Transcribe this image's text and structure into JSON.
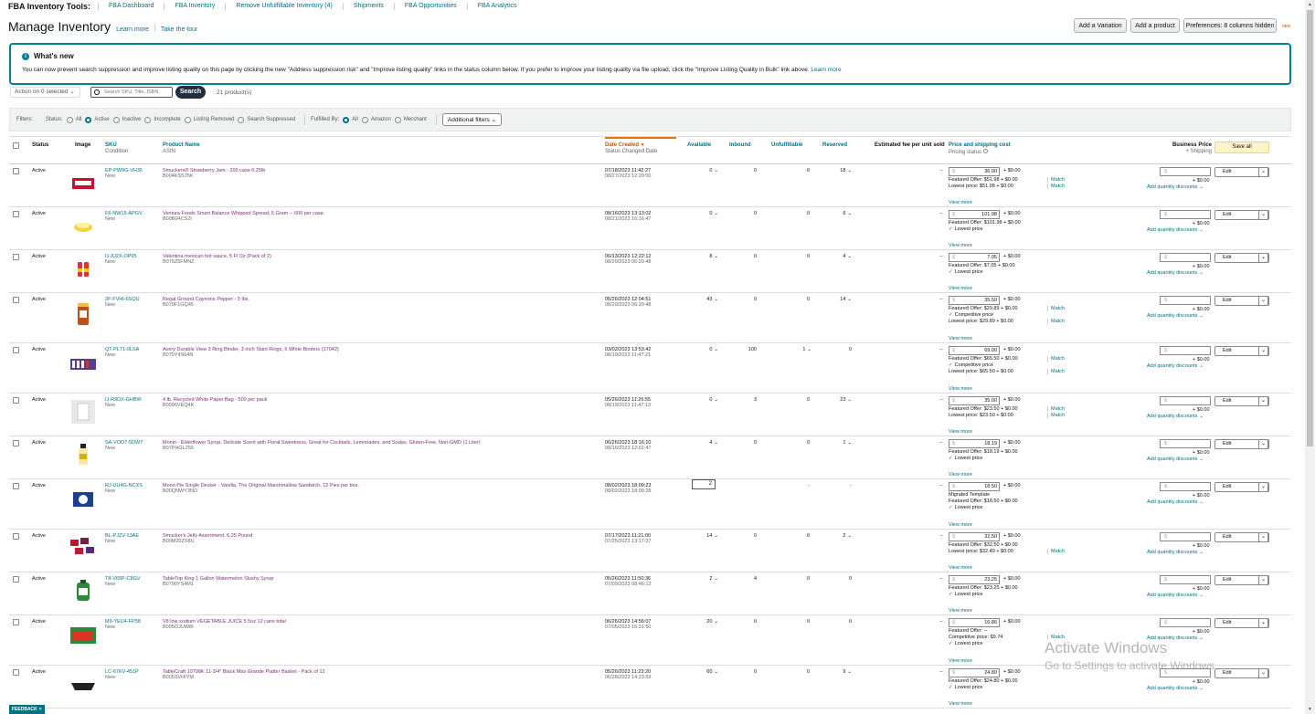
{
  "topnav": {
    "title": "FBA Inventory Tools:",
    "items": [
      "FBA Dashboard",
      "FBA Inventory",
      "Remove Unfulfillable Inventory (4)",
      "Shipments",
      "FBA Opportunities",
      "FBA Analytics"
    ]
  },
  "page": {
    "title": "Manage Inventory",
    "learn_more": "Learn more",
    "take_tour": "Take the tour"
  },
  "header_buttons": {
    "add_variation": "Add a Variation",
    "add_product": "Add a product",
    "preferences": "Preferences: 8 columns hidden",
    "new_tag": "new"
  },
  "whats_new": {
    "title": "What's new",
    "body": "You can now prevent search suppression and improve listing quality on this page by clicking the new \"Address suppression risk\" and \"Improve listing quality\" links in the status column below. If you prefer to improve your listing quality via file upload, click the \"Improve Listing Quality in Bulk\" link above.",
    "link": "Learn more"
  },
  "actionbar": {
    "action_label": "Action on 0 selected",
    "search_placeholder": "Search SKU, Title, ISBN,",
    "search_button": "Search",
    "count": "21 product(s)"
  },
  "filters": {
    "label": "Filters:",
    "status_label": "Status:",
    "status_options": [
      "All",
      "Active",
      "Inactive",
      "Incomplete",
      "Listing Removed",
      "Search Suppressed"
    ],
    "status_selected": "Active",
    "fulfilled_label": "Fulfilled By:",
    "fulfilled_options": [
      "All",
      "Amazon",
      "Merchant"
    ],
    "fulfilled_selected": "All",
    "additional": "Additional filters"
  },
  "columns": {
    "status": "Status",
    "image": "Image",
    "sku": "SKU",
    "sku_sub": "Condition",
    "product": "Product Name",
    "product_sub": "ASIN",
    "date": "Date Created",
    "date_sub": "Status Changed Date",
    "available": "Available",
    "inbound": "Inbound",
    "unfulfillable": "Unfulfillable",
    "reserved": "Reserved",
    "fee": "Estimated fee per unit sold",
    "price": "Price and shipping cost",
    "price_sub": "Pricing status",
    "business": "Business Price",
    "business_sub": "+ Shipping",
    "save_all": "Save all"
  },
  "common": {
    "view_more": "View more",
    "add_qty": "Add quantity discounts",
    "edit": "Edit",
    "plus_ship": "+ $0.00",
    "dash": "--"
  },
  "rows": [
    {
      "status": "Active",
      "sku": "EP-PW9G-VH35",
      "cond": "New",
      "name": "Smuckers® Strawberry Jam - 200 case 0.25lb",
      "asin": "B004KSS75K",
      "created": "07/18/2023 11:42:27",
      "changed": "08/27/2023 12:29:00",
      "avail": "0",
      "inbound": "0",
      "unful": "0",
      "reserved": "18",
      "price": "36.00",
      "ship": "+ $0.00",
      "lines": [
        "Featured Offer: $51.98 + $0.00",
        "Lowest price: $51.98 + $0.00"
      ],
      "match": [
        "Match",
        "Match"
      ],
      "check": "",
      "img": "jam"
    },
    {
      "status": "Active",
      "sku": "F6-NW15-APGV",
      "cond": "New",
      "name": "Ventura Foods Smart Balance Whipped Spread, 5 Gram -- 600 per case.",
      "asin": "B00B04CS2I",
      "created": "08/16/2023 13:13:02",
      "changed": "08/21/2023 16:16:47",
      "avail": "0",
      "inbound": "0",
      "unful": "0",
      "reserved": "6",
      "price": "101.98",
      "ship": "+ $0.00",
      "lines": [
        "Featured Offer: $101.98 + $0.00"
      ],
      "match": [],
      "check": "Lowest price",
      "img": "spread"
    },
    {
      "status": "Active",
      "sku": "I1-IU2X-OP95",
      "cond": "New",
      "name": "Valentina mexican hot sauce, 5 Fl Oz (Pack of 2)",
      "asin": "B076Z5FMNZ",
      "created": "06/13/2023 12:22:12",
      "changed": "08/20/2023 06:20:48",
      "avail": "8",
      "inbound": "0",
      "unful": "0",
      "reserved": "4",
      "price": "7.05",
      "ship": "+ $0.00",
      "lines": [
        "Featured Offer: $7.05 + $0.00"
      ],
      "match": [],
      "check": "Lowest price",
      "img": "sauce"
    },
    {
      "status": "Active",
      "sku": "2F-FVHI-6SQU",
      "cond": "New",
      "name": "Regal Ground Cayenne Pepper - 5 lbs.",
      "asin": "B079F1GQ45",
      "created": "05/26/2023 12:04:51",
      "changed": "08/20/2023 06:20:48",
      "avail": "43",
      "inbound": "0",
      "unful": "0",
      "reserved": "14",
      "price": "35.50",
      "ship": "+ $0.00",
      "lines": [
        "Featured Offer: $29.89 + $0.00",
        "Competitive price",
        "Lowest price: $29.89 + $0.00"
      ],
      "match": [
        "Match",
        "",
        "Match"
      ],
      "check": "",
      "img": "pepper"
    },
    {
      "status": "Active",
      "sku": "QT-PL71-0LSA",
      "cond": "New",
      "name": "Avery Durable View 3 Ring Binder, 3 Inch Slant Rings, 6 White Binders (17042)",
      "asin": "B079Y4S64N",
      "created": "03/02/2023 13:53:42",
      "changed": "08/19/2023 11:47:21",
      "avail": "0",
      "inbound": "100",
      "unful": "1",
      "reserved": "0",
      "price": "69.00",
      "ship": "+ $0.00",
      "lines": [
        "Featured Offer: $65.50 + $0.00",
        "Competitive price",
        "Lowest price: $65.50 + $0.00"
      ],
      "match": [
        "Match",
        "",
        "Match"
      ],
      "check": "",
      "img": "binder"
    },
    {
      "status": "Active",
      "sku": "IJ-R9DX-GHBW",
      "cond": "New",
      "name": "4 lb. Recycled White Paper Bag - 500 per pack",
      "asin": "B0096VEQ4K",
      "created": "05/26/2023 11:26:55",
      "changed": "08/19/2023 11:47:13",
      "avail": "0",
      "inbound": "3",
      "unful": "0",
      "reserved": "23",
      "price": "35.00",
      "ship": "+ $0.00",
      "lines": [
        "Featured Offer: $23.50 + $0.00",
        "Lowest price: $23.50 + $0.00"
      ],
      "match": [
        "Match",
        "Match"
      ],
      "check": "",
      "img": "bag"
    },
    {
      "status": "Active",
      "sku": "SA-VOD7-5DW7",
      "cond": "New",
      "name": "Monin - Elderflower Syrup, Delicate Scent with Floral Sweetness, Great for Cocktails, Lemonades, and Sodas, Gluten-Free, Non-GMO (1 Liter)",
      "asin": "B07PHGL255",
      "created": "06/26/2023 18:16:10",
      "changed": "08/16/2023 12:01:47",
      "avail": "4",
      "inbound": "0",
      "unful": "0",
      "reserved": "1",
      "price": "18.19",
      "ship": "+ $0.00",
      "lines": [
        "Featured Offer: $18.19 + $0.00"
      ],
      "match": [],
      "check": "Lowest price",
      "img": "syrup"
    },
    {
      "status": "Active",
      "sku": "RJ-UU4G-NCXS",
      "cond": "New",
      "name": "Moon Pie Single Decker - Vanilla, The Original Marshmallow Sandwich, 12 Pies per box.",
      "asin": "B00QNWY3NO",
      "created": "08/02/2023 18:09:23",
      "changed": "08/02/2023 18:09:28",
      "avail": "2",
      "inbound": "",
      "unful": "-",
      "reserved": "-",
      "price": "18.50",
      "ship": "+ $0.00",
      "lines": [
        "Migrated Template",
        "Featured Offer: $18.50 + $0.00"
      ],
      "match": [],
      "check": "Lowest price",
      "img": "moonpie"
    },
    {
      "status": "Active",
      "sku": "BL-PJZV-13AE",
      "cond": "New",
      "name": "Smucker's Jelly Assortment, 6.25 Pound",
      "asin": "B00M20ZX8U",
      "created": "07/17/2023 11:21:00",
      "changed": "07/25/2023 13:17:27",
      "avail": "14",
      "inbound": "0",
      "unful": "0",
      "reserved": "2",
      "price": "32.50",
      "ship": "+ $0.00",
      "lines": [
        "Featured Offer: $32.50 + $0.00",
        "Lowest price: $32.49 + $0.00"
      ],
      "match": [
        "",
        "Match"
      ],
      "check": "",
      "img": "jelly"
    },
    {
      "status": "Active",
      "sku": "T8-V65P-C8GV",
      "cond": "New",
      "name": "TableTop King 1 Gallon Watermelon Slushy Syrup",
      "asin": "B0790YS4M1",
      "created": "05/26/2023 11:50:36",
      "changed": "07/09/2023 08:46:13",
      "avail": "2",
      "inbound": "4",
      "unful": "0",
      "reserved": "0",
      "price": "23.25",
      "ship": "+ $0.00",
      "lines": [
        "Featured Offer: $23.25 + $0.00"
      ],
      "match": [],
      "check": "Lowest price",
      "img": "slushy"
    },
    {
      "status": "Active",
      "sku": "M9-YEU4-FP58",
      "cond": "New",
      "name": "V8 low sodium VEGETABLE JUICE 5.5oz 12 cans total",
      "asin": "B005OJUW8I",
      "created": "06/26/2023 14:56:07",
      "changed": "07/05/2023 15:21:50",
      "avail": "20",
      "inbound": "0",
      "unful": "0",
      "reserved": "0",
      "price": "16.86",
      "ship": "+ $0.00",
      "lines": [
        "Featured Offer: --",
        "Competitive price: $9.74"
      ],
      "match": [
        "",
        "Match"
      ],
      "check": "Lowest price",
      "img": "v8"
    },
    {
      "status": "Active",
      "sku": "LC-67KV-451P",
      "cond": "New",
      "name": "TableCraft 10798K 11-3/4\" Black Mas Grande Platter Basket - Pack of 12",
      "asin": "B005SVHIYM",
      "created": "05/26/2023 11:23:20",
      "changed": "06/28/2023 14:23:59",
      "avail": "60",
      "inbound": "0",
      "unful": "0",
      "reserved": "9",
      "price": "24.80",
      "ship": "+ $0.00",
      "lines": [
        "Featured Offer: $24.80 + $0.00"
      ],
      "match": [],
      "check": "Lowest price",
      "img": "basket"
    }
  ],
  "feedback": "FEEDBACK",
  "watermark": {
    "line1": "Activate Windows",
    "line2": "Go to Settings to activate Windows."
  }
}
